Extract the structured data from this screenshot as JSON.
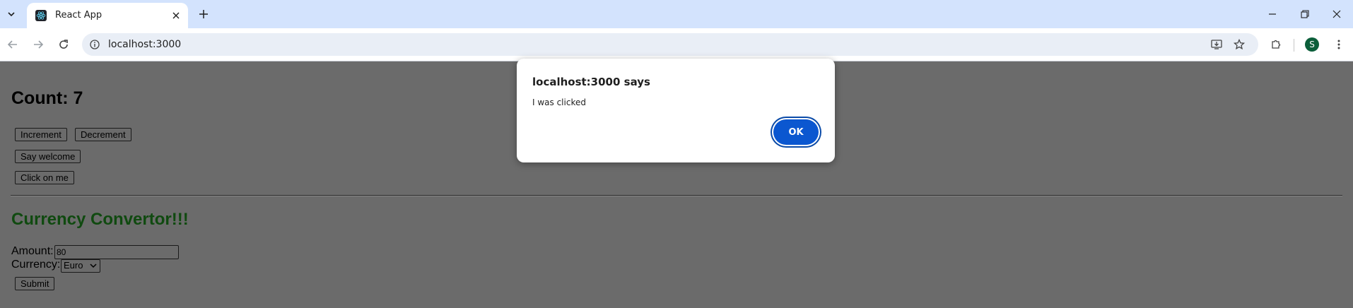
{
  "browser": {
    "tab_title": "React App",
    "url": "localhost:3000",
    "profile_initial": "S"
  },
  "page": {
    "count_text": "Count: 7",
    "buttons": {
      "increment": "Increment",
      "decrement": "Decrement",
      "say_welcome": "Say welcome",
      "click_on_me": "Click on me"
    },
    "converter": {
      "title": "Currency Convertor!!!",
      "amount_label": "Amount:",
      "amount_value": "80",
      "currency_label": "Currency:",
      "currency_selected": "Euro",
      "submit_label": "Submit",
      "title_color": "#104a10"
    }
  },
  "dialog": {
    "title": "localhost:3000 says",
    "message": "I was clicked",
    "ok_label": "OK"
  },
  "colors": {
    "overlay": "#6b6b6b",
    "accent": "#0b57d0",
    "tabbar": "#d3e3fd"
  }
}
